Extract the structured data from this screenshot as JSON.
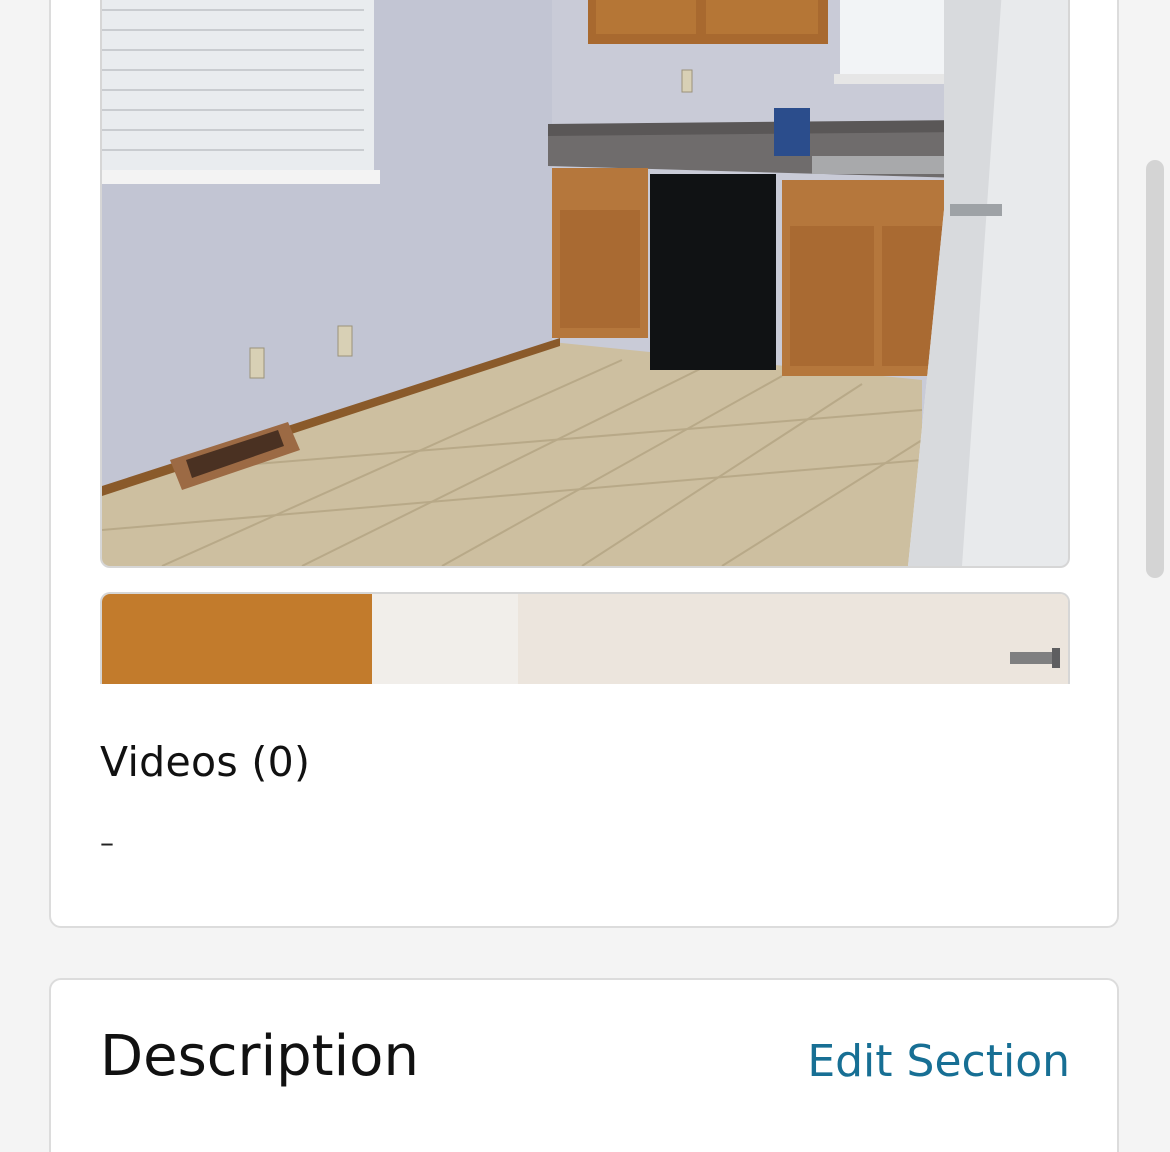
{
  "media": {
    "photos": [
      {
        "name": "kitchen-photo"
      },
      {
        "name": "second-photo"
      }
    ],
    "videos_title": "Videos (0)",
    "videos_empty": "–"
  },
  "description": {
    "title": "Description",
    "edit_label": "Edit Section"
  },
  "colors": {
    "link": "#176f94",
    "card_border": "#dcdcdc",
    "background": "#f4f4f4"
  }
}
